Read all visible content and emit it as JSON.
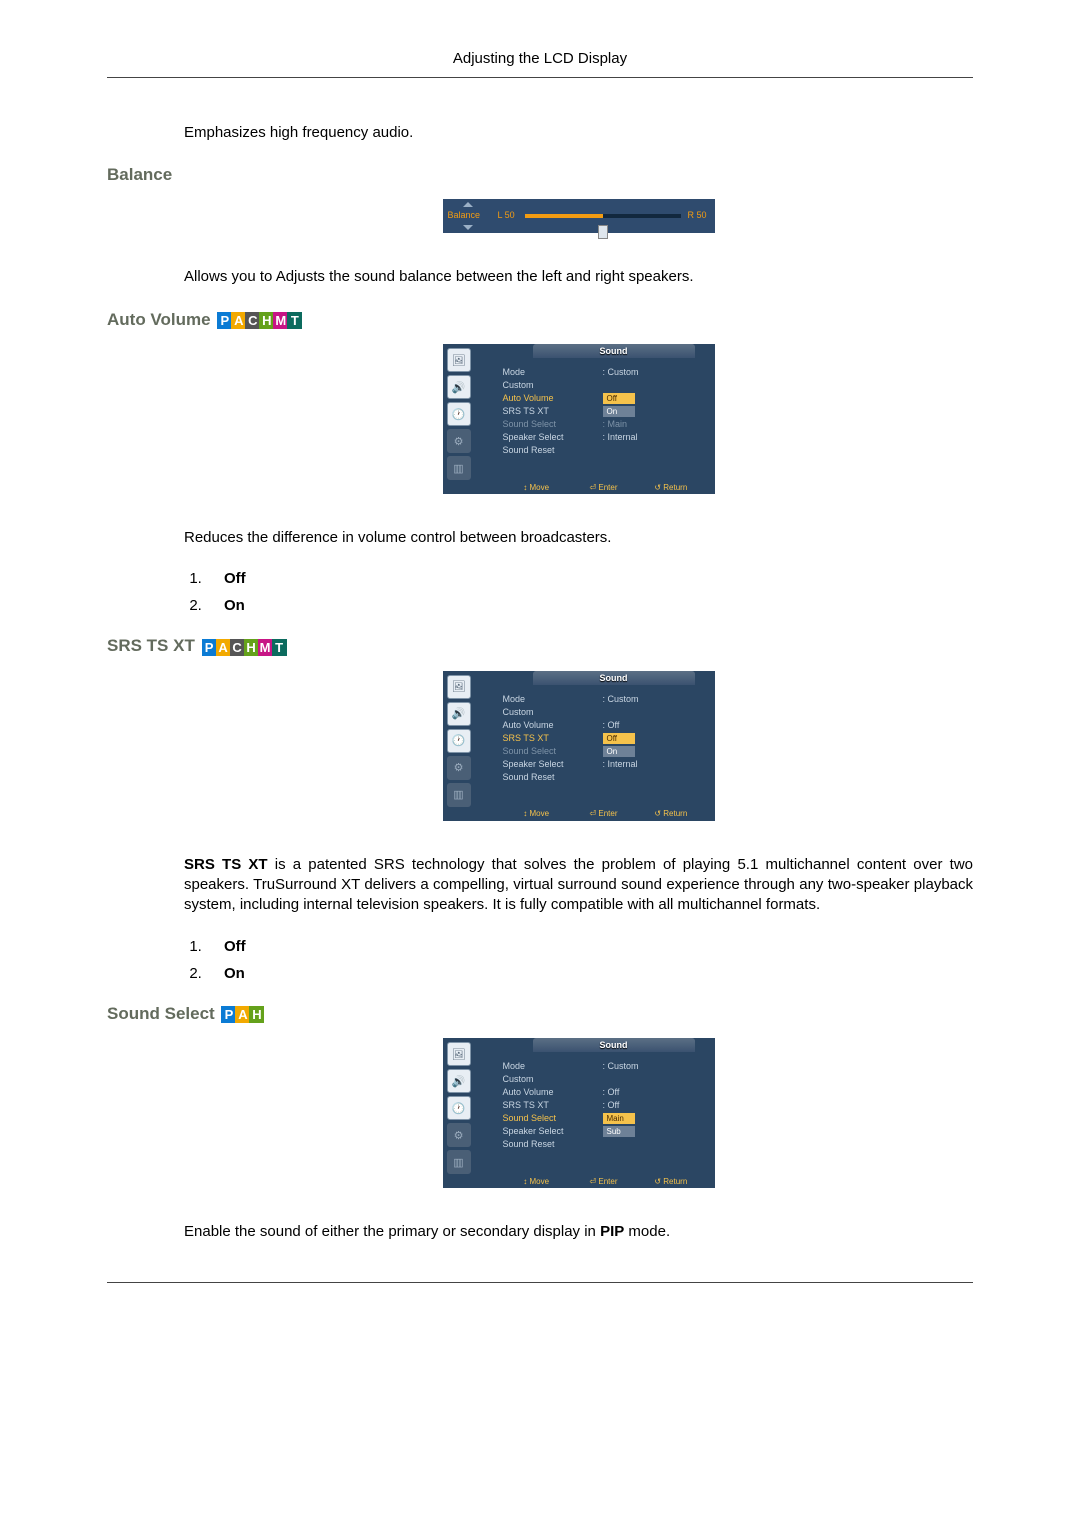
{
  "header": "Adjusting the LCD Display",
  "intro_text": "Emphasizes high frequency audio.",
  "sections": {
    "balance": {
      "heading": "Balance",
      "fig": {
        "label": "Balance",
        "left": "L 50",
        "right": "R 50"
      },
      "desc": "Allows you to Adjusts the sound balance between the left and right speakers."
    },
    "auto_volume": {
      "heading": "Auto Volume",
      "desc": "Reduces the difference in volume control between broadcasters.",
      "options": [
        "Off",
        "On"
      ]
    },
    "srs": {
      "heading": "SRS TS XT",
      "desc_lead": "SRS TS XT",
      "desc_rest": " is a patented SRS technology that solves the problem of playing 5.1 multichannel content over two speakers. TruSurround XT delivers a compelling, virtual surround sound experience through any two-speaker playback system, including internal television speakers. It is fully compatible with all multichannel formats.",
      "options": [
        "Off",
        "On"
      ]
    },
    "sound_select": {
      "heading": "Sound Select",
      "desc_pre": "Enable the sound of either the primary or secondary display in ",
      "desc_bold": "PIP",
      "desc_post": " mode."
    }
  },
  "osd_common": {
    "title": "Sound",
    "footer": {
      "move": "Move",
      "enter": "Enter",
      "return": "Return"
    },
    "labels": {
      "mode": "Mode",
      "custom": "Custom",
      "auto_volume": "Auto Volume",
      "srs": "SRS TS XT",
      "sound_select": "Sound Select",
      "speaker_select": "Speaker Select",
      "sound_reset": "Sound Reset"
    }
  },
  "osd_auto_volume": {
    "mode_val": "Custom",
    "opts": [
      "Off",
      "On"
    ],
    "sound_select_val": "Main",
    "speaker_val": "Internal"
  },
  "osd_srs": {
    "mode_val": "Custom",
    "auto_vol_val": "Off",
    "opts": [
      "Off",
      "On"
    ],
    "speaker_val": "Internal"
  },
  "osd_sound_select": {
    "mode_val": "Custom",
    "auto_vol_val": "Off",
    "srs_val": "Off",
    "opts": [
      "Main",
      "Sub"
    ]
  }
}
